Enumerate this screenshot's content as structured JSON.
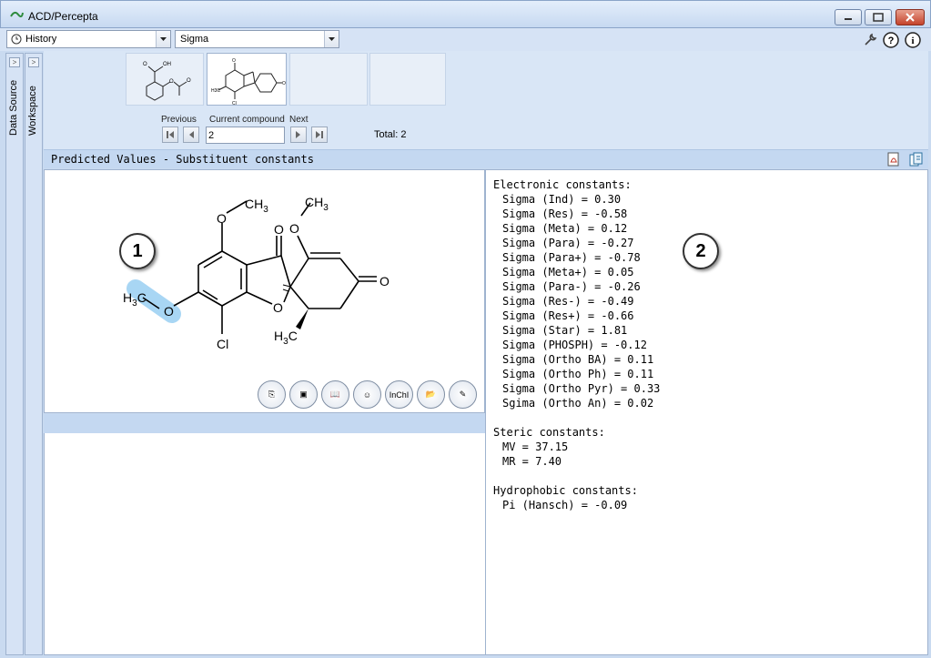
{
  "window": {
    "title": "ACD/Percepta"
  },
  "toolbar": {
    "history_label": "History",
    "module_value": "Sigma"
  },
  "side_tabs": {
    "data_source": "Data Source",
    "workspace": "Workspace"
  },
  "navigation": {
    "previous_label": "Previous",
    "current_label": "Current compound",
    "next_label": "Next",
    "current_value": "2",
    "total_label": "Total: 2"
  },
  "panel": {
    "title": "Predicted Values - Substituent constants"
  },
  "structure": {
    "callout": "1",
    "atom_labels": {
      "ch3_top": "CH",
      "ch3_top_sub": "3",
      "ch3_right": "CH",
      "ch3_right_sub": "3",
      "o1": "O",
      "o2": "O",
      "o3": "O",
      "o4": "O",
      "o5": "O",
      "o6": "O",
      "h3c_left": "H",
      "h3c_left_sub": "3",
      "h3c_left_c": "C",
      "cl": "Cl",
      "h3c_bottom": "H",
      "h3c_bottom_sub": "3",
      "h3c_bottom_c": "C"
    },
    "tools": [
      {
        "name": "copy-structure-icon",
        "glyph": "⎘"
      },
      {
        "name": "copy-image-icon",
        "glyph": "▣"
      },
      {
        "name": "book-icon",
        "glyph": "📖"
      },
      {
        "name": "smiles-icon",
        "glyph": "☺"
      },
      {
        "name": "inchi-icon",
        "glyph": "InChI"
      },
      {
        "name": "open-icon",
        "glyph": "📂"
      },
      {
        "name": "edit-icon",
        "glyph": "✎"
      }
    ]
  },
  "results": {
    "callout": "2",
    "electronic": {
      "title": "Electronic constants:",
      "rows": [
        "Sigma (Ind) = 0.30",
        "Sigma (Res) = -0.58",
        "Sigma (Meta) = 0.12",
        "Sigma (Para) = -0.27",
        "Sigma (Para+) = -0.78",
        "Sigma (Meta+) = 0.05",
        "Sigma (Para-) = -0.26",
        "Sigma (Res-) = -0.49",
        "Sigma (Res+) = -0.66",
        "Sigma (Star) = 1.81",
        "Sigma (PHOSPH) = -0.12",
        "Sigma (Ortho BA) = 0.11",
        "Sigma (Ortho Ph) = 0.11",
        "Sigma (Ortho Pyr) = 0.33",
        "Sgima (Ortho An) = 0.02"
      ]
    },
    "steric": {
      "title": "Steric constants:",
      "rows": [
        "MV = 37.15",
        "MR = 7.40"
      ]
    },
    "hydrophobic": {
      "title": "Hydrophobic constants:",
      "rows": [
        "Pi (Hansch) = -0.09"
      ]
    }
  },
  "colors": {
    "chrome": "#c9daf0",
    "header": "#c4d8f1",
    "highlight": "#9fd0f2"
  }
}
